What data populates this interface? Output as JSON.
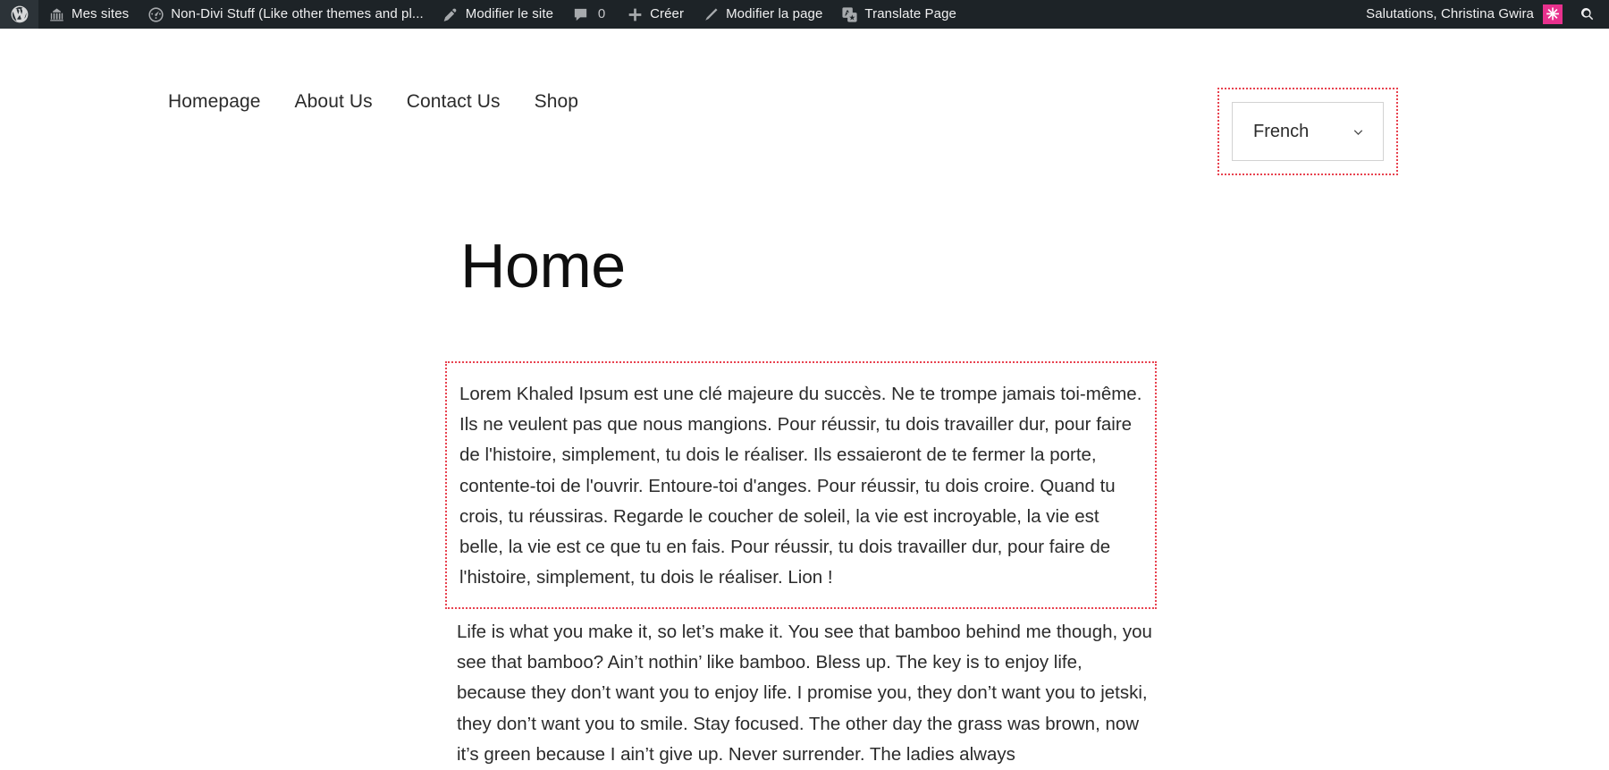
{
  "adminbar": {
    "wp_logo": "wordpress-logo-icon",
    "left_items": [
      {
        "icon": "my-sites-icon",
        "label": "Mes sites"
      },
      {
        "icon": "dashboard-gauge-icon",
        "label": "Non-Divi Stuff (Like other themes and pl..."
      },
      {
        "icon": "customize-pin-icon",
        "label": "Modifier le site"
      },
      {
        "icon": "comment-bubble-icon",
        "label": "",
        "count": "0"
      },
      {
        "icon": "plus-icon",
        "label": "Créer"
      },
      {
        "icon": "pencil-icon",
        "label": "Modifier la page"
      },
      {
        "icon": "translate-icon",
        "label": "Translate Page"
      }
    ],
    "greeting": "Salutations, Christina Gwira",
    "avatar_glyph": "✳",
    "avatar_color": "#e8318d",
    "search_icon": "search-icon"
  },
  "nav": {
    "items": [
      {
        "label": "Homepage"
      },
      {
        "label": "About Us"
      },
      {
        "label": "Contact Us"
      },
      {
        "label": "Shop"
      }
    ]
  },
  "language_switcher": {
    "selected": "French",
    "chevron": "chevron-down-icon",
    "highlight_color": "#e8424f"
  },
  "page": {
    "title": "Home",
    "paragraph_fr": "Lorem Khaled Ipsum est une clé majeure du succès. Ne te trompe jamais toi-même. Ils ne veulent pas que nous mangions. Pour réussir, tu dois travailler dur, pour faire de l'histoire, simplement, tu dois le réaliser. Ils essaieront de te fermer la porte, contente-toi de l'ouvrir. Entoure-toi d'anges. Pour réussir, tu dois croire. Quand tu crois, tu réussiras. Regarde le coucher de soleil, la vie est incroyable, la vie est belle, la vie est ce que tu en fais. Pour réussir, tu dois travailler dur, pour faire de l'histoire, simplement, tu dois le réaliser. Lion !",
    "paragraph_en": "Life is what you make it, so let’s make it. You see that bamboo behind me though, you see that bamboo? Ain’t nothin’ like bamboo. Bless up. The key is to enjoy life, because they don’t want you to enjoy life. I promise you, they don’t want you to jetski, they don’t want you to smile. Stay focused. The other day the grass was brown, now it’s green because I ain’t give up. Never surrender. The ladies always"
  }
}
